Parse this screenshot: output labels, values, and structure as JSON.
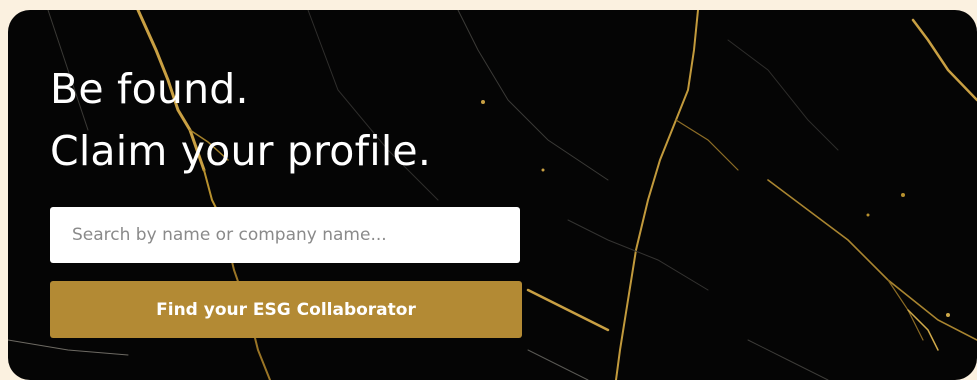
{
  "hero": {
    "heading_line_1": "Be found.",
    "heading_line_2": "Claim your profile.",
    "search_placeholder": "Search by name or company name...",
    "search_value": "",
    "button_label": "Find your ESG Collaborator"
  },
  "colors": {
    "page_background": "#fbf1e0",
    "card_background": "#050505",
    "vein_gold": "#c9a043",
    "button_background": "#b38a34",
    "button_text": "#ffffff",
    "heading_text": "#ffffff",
    "input_background": "#ffffff",
    "placeholder_text": "#8a8a8a"
  }
}
